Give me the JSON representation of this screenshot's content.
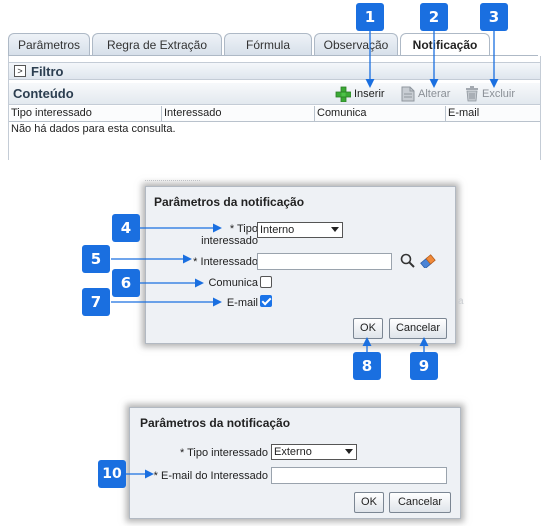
{
  "tabs": [
    {
      "label": "Parâmetros"
    },
    {
      "label": "Regra de Extração"
    },
    {
      "label": "Fórmula"
    },
    {
      "label": "Observação"
    },
    {
      "label": "Notificação"
    }
  ],
  "filter": {
    "label": "Filtro",
    "toggle": ">"
  },
  "content": {
    "title": "Conteúdo",
    "toolbar": {
      "insert": "Inserir",
      "edit": "Alterar",
      "delete": "Excluir"
    },
    "columns": [
      "Tipo interessado",
      "Interessado",
      "Comunica",
      "E-mail"
    ],
    "empty_message": "Não há dados para esta consulta."
  },
  "dialog1": {
    "title": "Parâmetros da notificação",
    "tipo_label_line1": "* Tipo",
    "tipo_label_line2": "interessado",
    "tipo_value": "Interno",
    "interessado_label": "* Interessado",
    "interessado_value": "",
    "comunica_label": "Comunica",
    "comunica_checked": false,
    "email_label": "E-mail",
    "email_checked": true,
    "ok": "OK",
    "cancel": "Cancelar"
  },
  "dialog2": {
    "title": "Parâmetros da notificação",
    "tipo_label": "* Tipo interessado",
    "tipo_value": "Externo",
    "email_label": "* E-mail do Interessado",
    "email_value": "",
    "ok": "OK",
    "cancel": "Cancelar"
  },
  "callouts": [
    "1",
    "2",
    "3",
    "4",
    "5",
    "6",
    "7",
    "8",
    "9",
    "10"
  ],
  "colors": {
    "callout": "#1a6fe0",
    "insert_icon": "#3aa935",
    "checkbox": "#1a73e8"
  }
}
